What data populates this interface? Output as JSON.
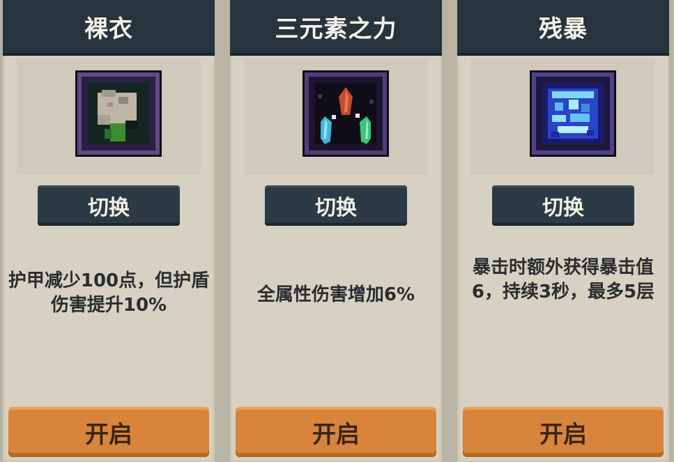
{
  "cards": [
    {
      "title": "裸衣",
      "icon": "bare-clothes-icon",
      "switch_label": "切换",
      "description": "护甲减少100点，但护盾伤害提升10%",
      "open_label": "开启"
    },
    {
      "title": "三元素之力",
      "icon": "three-elements-icon",
      "switch_label": "切换",
      "description": "全属性伤害增加6%",
      "open_label": "开启"
    },
    {
      "title": "残暴",
      "icon": "brutality-icon",
      "switch_label": "切换",
      "description": "暴击时额外获得暴击值6，持续3秒，最多5层",
      "open_label": "开启"
    }
  ],
  "colors": {
    "title_bar": "#27343d",
    "card_bg": "#d6d1c2",
    "switch_button": "#2b3a44",
    "open_button": "#d8843a"
  }
}
